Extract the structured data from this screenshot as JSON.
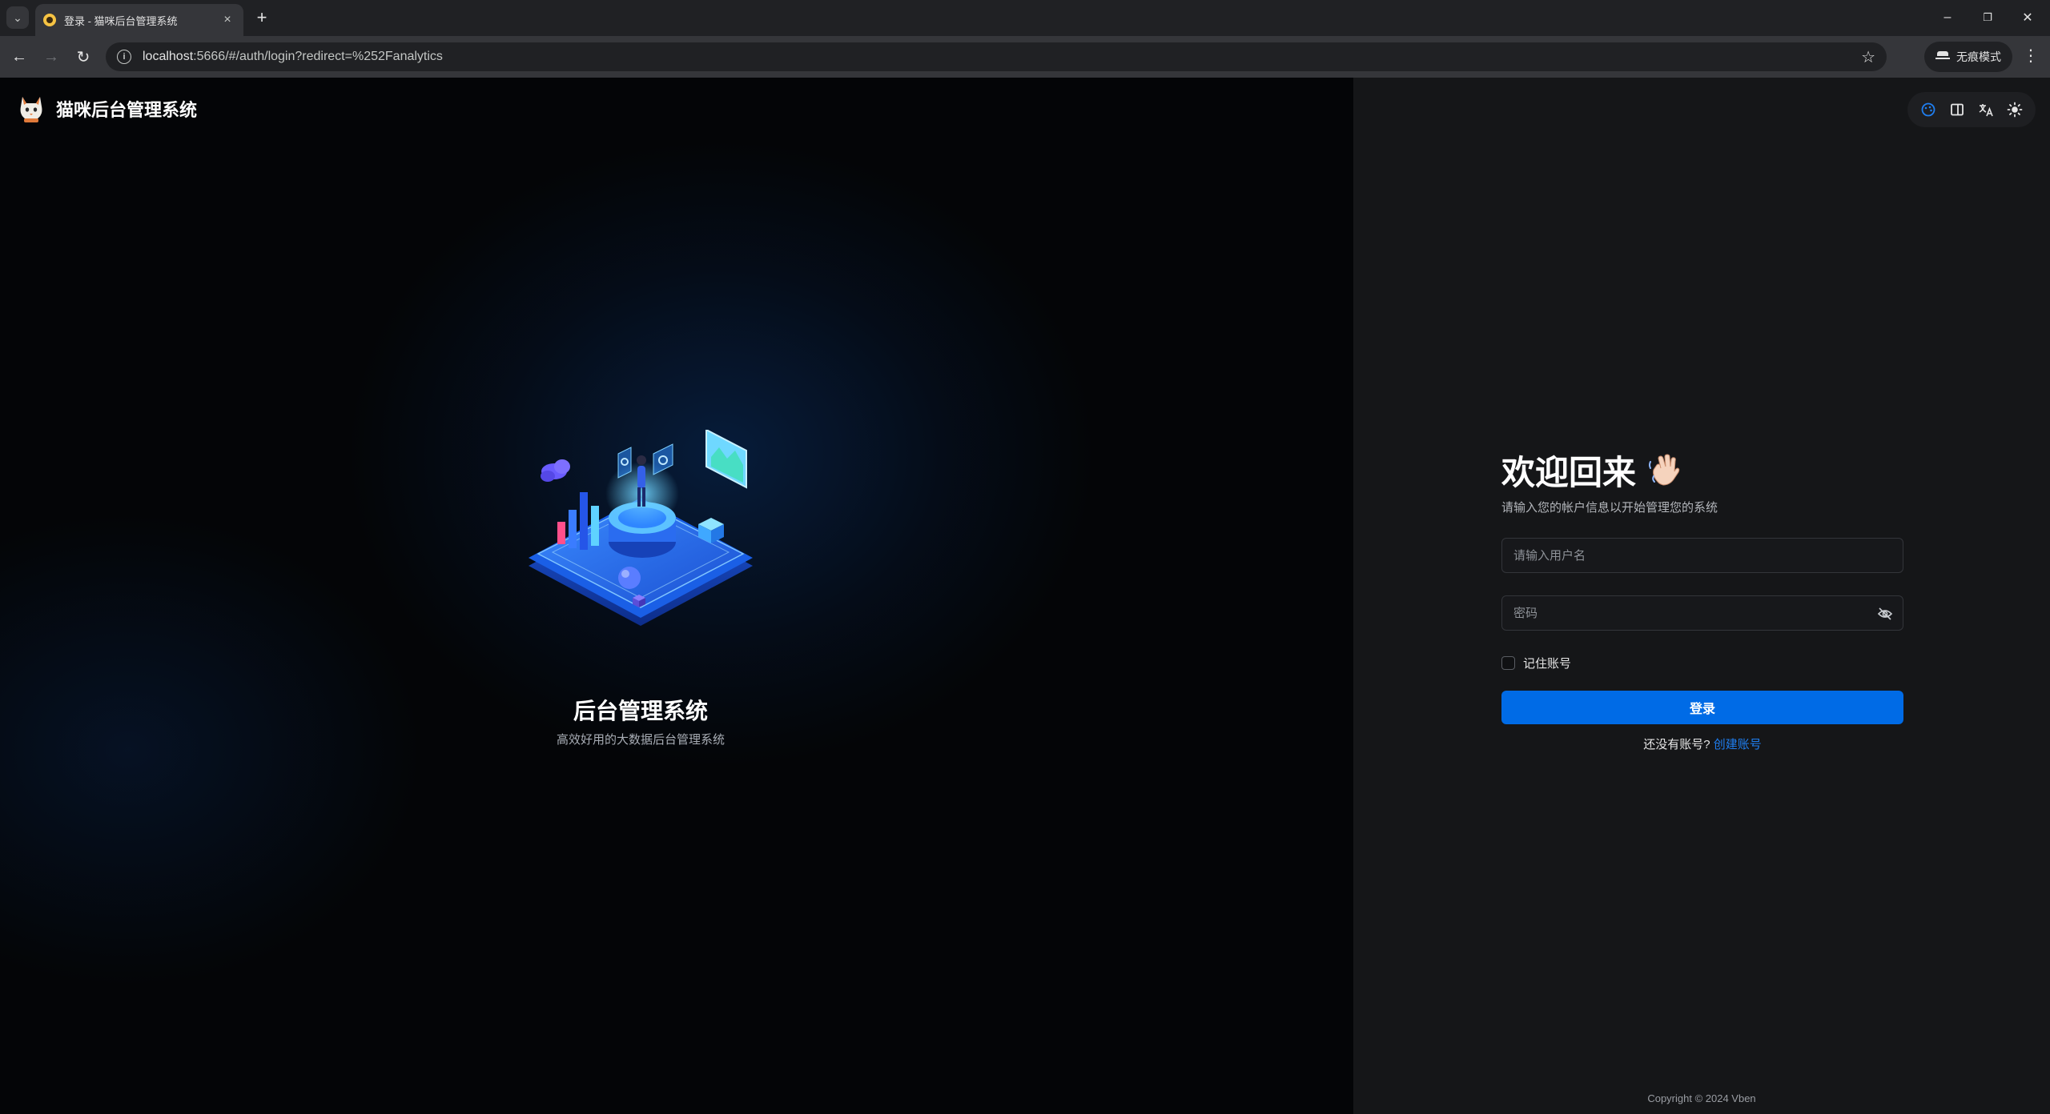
{
  "browser": {
    "tab_title": "登录 - 猫咪后台管理系统",
    "tab_close": "×",
    "new_tab": "+",
    "url_host": "localhost",
    "url_rest": ":5666/#/auth/login?redirect=%252Fanalytics",
    "incognito_label": "无痕模式",
    "window_controls": {
      "minimize": "–",
      "restore": "❐",
      "close": "✕"
    },
    "nav": {
      "back": "←",
      "forward": "→",
      "reload": "↻"
    },
    "star": "☆",
    "menu": "⋮",
    "tab_menu": "⌄"
  },
  "app": {
    "brand_title": "猫咪后台管理系统",
    "hero_title": "后台管理系统",
    "hero_subtitle": "高效好用的大数据后台管理系统",
    "toolbar_icons": [
      "palette-icon",
      "layout-icon",
      "translate-icon",
      "sun-icon"
    ],
    "accent_color": "#006be6"
  },
  "login": {
    "welcome": "欢迎回来",
    "subtitle": "请输入您的帐户信息以开始管理您的系统",
    "username_placeholder": "请输入用户名",
    "password_placeholder": "密码",
    "remember_label": "记住账号",
    "submit_label": "登录",
    "no_account_text": "还没有账号?",
    "create_account_link": "创建账号"
  },
  "footer": {
    "copyright": "Copyright © 2024 Vben"
  }
}
